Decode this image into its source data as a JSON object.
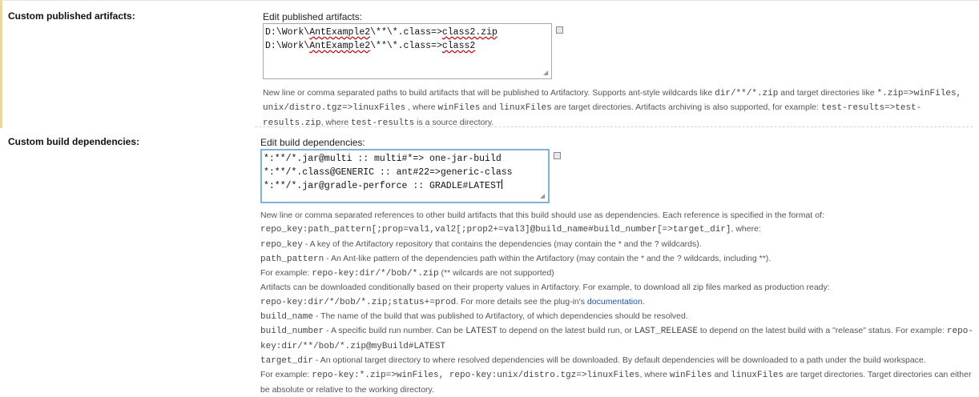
{
  "published": {
    "label": "Custom published artifacts:",
    "caption": "Edit published artifacts:",
    "lines": [
      {
        "a": "D:\\Work\\",
        "b": "AntExample2",
        "c": "\\**\\*.class=>",
        "d": "class2.zip"
      },
      {
        "a": "D:\\Work\\",
        "b": "AntExample2",
        "c": "\\**\\*.class=>",
        "d": "class2"
      }
    ],
    "help": [
      {
        "t": "New line or comma separated paths to build artifacts that will be published to Artifactory. Supports ant-style wildcards like "
      },
      {
        "c": "dir/**/*.zip"
      },
      {
        "t": " and target directories like "
      },
      {
        "c": "*.zip=>winFiles, unix/distro.tgz=>linuxFiles"
      },
      {
        "t": " , where "
      },
      {
        "c": "winFiles"
      },
      {
        "t": " and "
      },
      {
        "c": "linuxFiles"
      },
      {
        "t": " are target directories. Artifacts archiving is also supported, for example: "
      },
      {
        "c": "test-results=>test-results.zip"
      },
      {
        "t": ", where "
      },
      {
        "c": "test-results"
      },
      {
        "t": " is a source directory."
      }
    ]
  },
  "dependencies": {
    "label": "Custom build dependencies:",
    "caption": "Edit build dependencies:",
    "lines": [
      "*:**/*.jar@multi :: multi#*=> one-jar-build",
      "*:**/*.class@GENERIC :: ant#22=>generic-class",
      "*:**/*.jar@gradle-perforce :: GRADLE#LATEST"
    ],
    "help": [
      [
        {
          "t": "New line or comma separated references to other build artifacts that this build should use as dependencies. Each reference is specified in the format of:"
        }
      ],
      [
        {
          "c": "repo_key:path_pattern[;prop=val1,val2[;prop2+=val3]@build_name#build_number[=>target_dir]"
        },
        {
          "t": ", where:"
        }
      ],
      [
        {
          "c": "repo_key"
        },
        {
          "t": " - A key of the Artifactory repository that contains the dependencies (may contain the * and the ? wildcards)."
        }
      ],
      [
        {
          "c": "path_pattern"
        },
        {
          "t": " - An Ant-like pattern of the dependencies path within the Artifactory (may contain the * and the ? wildcards, including **)."
        }
      ],
      [
        {
          "t": "For example: "
        },
        {
          "c": "repo-key:dir/*/bob/*.zip"
        },
        {
          "t": " (** wilcards are not supported)"
        }
      ],
      [
        {
          "t": "Artifacts can be downloaded conditionally based on their property values in Artifactory. For example, to download all zip files marked as production ready:"
        }
      ],
      [
        {
          "c": "repo-key:dir/*/bob/*.zip;status+=prod"
        },
        {
          "t": ". For more details see the plug-in's "
        },
        {
          "a": "documentation"
        },
        {
          "t": "."
        }
      ],
      [
        {
          "c": "build_name"
        },
        {
          "t": " - The name of the build that was published to Artifactory, of which dependencies should be resolved."
        }
      ],
      [
        {
          "c": "build_number"
        },
        {
          "t": " - A specific build run number. Can be "
        },
        {
          "c": "LATEST"
        },
        {
          "t": " to depend on the latest build run, or "
        },
        {
          "c": "LAST_RELEASE"
        },
        {
          "t": " to depend on the latest build with a \"release\" status. For example: "
        },
        {
          "c": "repo-key:dir/**/bob/*.zip@myBuild#LATEST"
        }
      ],
      [
        {
          "c": "target_dir"
        },
        {
          "t": " - An optional target directory to where resolved dependencies will be downloaded. By default dependencies will be downloaded to a path under the build workspace."
        }
      ],
      [
        {
          "t": "For example: "
        },
        {
          "c": "repo-key:*.zip=>winFiles, repo-key:unix/distro.tgz=>linuxFiles"
        },
        {
          "t": ", where "
        },
        {
          "c": "winFiles"
        },
        {
          "t": " and "
        },
        {
          "c": "linuxFiles"
        },
        {
          "t": " are target directories. Target directories can either be absolute or relative to the working directory."
        }
      ]
    ]
  },
  "colors": {
    "accent_border": "#f0d98a",
    "focus_border": "#7fb2e0",
    "link": "#1a55b5"
  },
  "icons": {
    "expand": "expand-textarea-icon",
    "resize": "resize-grip-icon"
  }
}
